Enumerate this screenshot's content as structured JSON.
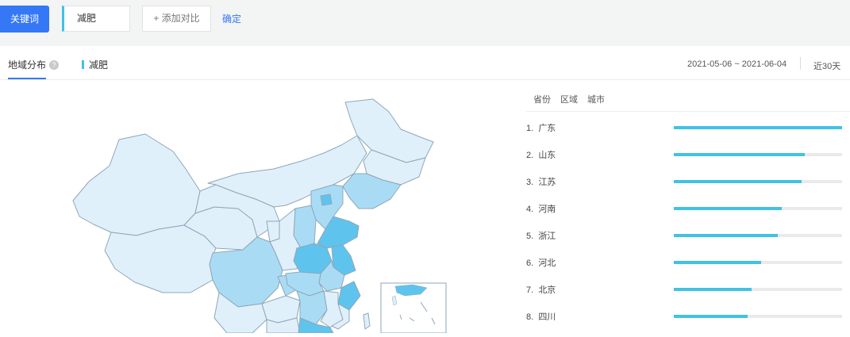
{
  "toolbar": {
    "keyword_button": "关键词",
    "keyword_value": "减肥",
    "add_compare": "+ 添加对比",
    "confirm": "确定"
  },
  "tabs": {
    "region_title": "地域分布",
    "help_glyph": "?",
    "legend_label": "减肥",
    "date_range": "2021-05-06 ~ 2021-06-04",
    "period": "近30天"
  },
  "panel": {
    "tabs": [
      "省份",
      "区域",
      "城市"
    ]
  },
  "ranking": [
    {
      "rank": "1.",
      "name": "广东",
      "value": 1.0
    },
    {
      "rank": "2.",
      "name": "山东",
      "value": 0.78
    },
    {
      "rank": "3.",
      "name": "江苏",
      "value": 0.76
    },
    {
      "rank": "4.",
      "name": "河南",
      "value": 0.64
    },
    {
      "rank": "5.",
      "name": "浙江",
      "value": 0.62
    },
    {
      "rank": "6.",
      "name": "河北",
      "value": 0.52
    },
    {
      "rank": "7.",
      "name": "北京",
      "value": 0.46
    },
    {
      "rank": "8.",
      "name": "四川",
      "value": 0.44
    }
  ],
  "colors": {
    "accent": "#3478f6",
    "bar": "#3fc2e6",
    "map_light": "#dff0fb",
    "map_mid": "#a9dcf4",
    "map_strong": "#5ec4ee",
    "map_border": "#8fa6b8"
  }
}
